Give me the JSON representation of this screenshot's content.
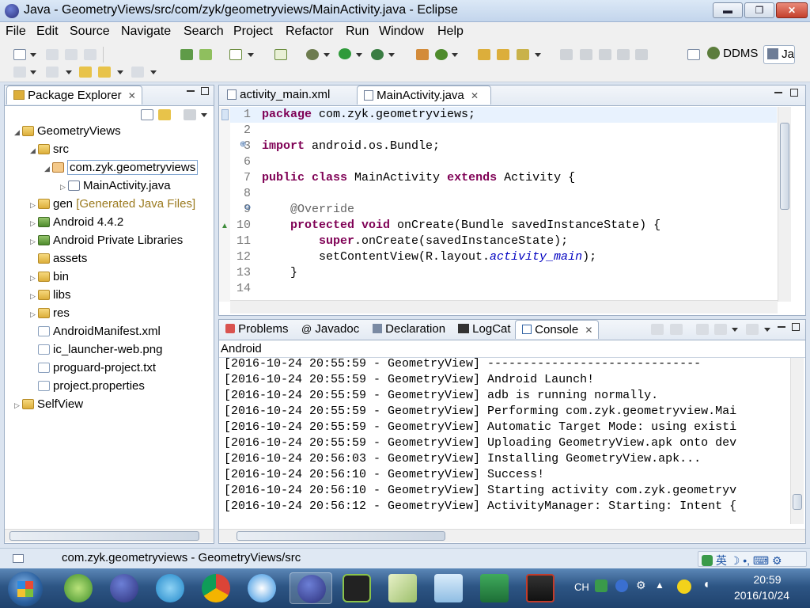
{
  "window": {
    "title": "Java - GeometryViews/src/com/zyk/geometryviews/MainActivity.java - Eclipse",
    "min_glyph": "▬",
    "max_glyph": "❐",
    "close_glyph": "✕"
  },
  "menu": [
    "File",
    "Edit",
    "Source",
    "Navigate",
    "Search",
    "Project",
    "Refactor",
    "Run",
    "Window",
    "Help"
  ],
  "perspectives": {
    "ddms": "DDMS",
    "java": "Ja"
  },
  "package_explorer": {
    "tab_label": "Package Explorer",
    "tree": [
      {
        "label": "GeometryViews",
        "arrow": "◢",
        "icon": "proj"
      },
      {
        "label": "src",
        "arrow": "◢",
        "icon": "folder"
      },
      {
        "label": "com.zyk.geometryviews",
        "arrow": "◢",
        "icon": "pkg"
      },
      {
        "label": "MainActivity.java",
        "arrow": "▷",
        "icon": "jfile"
      },
      {
        "label": "gen",
        "suffix": "[Generated Java Files]",
        "arrow": "▷",
        "icon": "folder"
      },
      {
        "label": "Android 4.4.2",
        "arrow": "▷",
        "icon": "lib"
      },
      {
        "label": "Android Private Libraries",
        "arrow": "▷",
        "icon": "lib"
      },
      {
        "label": "assets",
        "arrow": "",
        "icon": "folder"
      },
      {
        "label": "bin",
        "arrow": "▷",
        "icon": "folder"
      },
      {
        "label": "libs",
        "arrow": "▷",
        "icon": "folder"
      },
      {
        "label": "res",
        "arrow": "▷",
        "icon": "folder"
      },
      {
        "label": "AndroidManifest.xml",
        "arrow": "",
        "icon": "file"
      },
      {
        "label": "ic_launcher-web.png",
        "arrow": "",
        "icon": "file"
      },
      {
        "label": "proguard-project.txt",
        "arrow": "",
        "icon": "file"
      },
      {
        "label": "project.properties",
        "arrow": "",
        "icon": "file"
      },
      {
        "label": "SelfView",
        "arrow": "▷",
        "icon": "proj"
      }
    ]
  },
  "editor": {
    "tabs": [
      "activity_main.xml",
      "MainActivity.java"
    ],
    "lines": [
      {
        "n": "1",
        "html_parts": [
          [
            "kw",
            "package"
          ],
          [
            "",
            "com.zyk.geometryviews;"
          ]
        ]
      },
      {
        "n": "2",
        "html_parts": []
      },
      {
        "n": "3",
        "html_parts": [
          [
            "kw",
            "import"
          ],
          [
            "",
            "android.os.Bundle;"
          ]
        ]
      },
      {
        "n": "6",
        "html_parts": []
      },
      {
        "n": "7",
        "html_parts": [
          [
            "kw",
            "public"
          ],
          [
            "kw",
            "class"
          ],
          [
            "",
            "MainActivity"
          ],
          [
            "kw",
            "extends"
          ],
          [
            "",
            "Activity {"
          ]
        ]
      },
      {
        "n": "8",
        "html_parts": []
      },
      {
        "n": "9",
        "html_parts": [
          [
            "ann",
            "    @Override"
          ]
        ]
      },
      {
        "n": "10",
        "html_parts": [
          [
            "kw",
            "    protected"
          ],
          [
            "kw",
            "void"
          ],
          [
            "",
            "onCreate(Bundle savedInstanceState) {"
          ]
        ]
      },
      {
        "n": "11",
        "html_parts": [
          [
            "kw",
            "        super"
          ],
          [
            "",
            ".onCreate(savedInstanceState);"
          ]
        ]
      },
      {
        "n": "12",
        "html_parts": [
          [
            "",
            "        setContentView(R.layout."
          ],
          [
            "ital",
            "activity_main"
          ],
          [
            "",
            ");"
          ]
        ]
      },
      {
        "n": "13",
        "html_parts": [
          [
            "",
            "    }"
          ]
        ]
      },
      {
        "n": "14",
        "html_parts": []
      }
    ]
  },
  "bottom": {
    "tabs": [
      "Problems",
      "Javadoc",
      "Declaration",
      "LogCat",
      "Console"
    ],
    "console_label": "Android",
    "lines": [
      "[2016-10-24 20:55:59 - GeometryView] ------------------------------",
      "[2016-10-24 20:55:59 - GeometryView] Android Launch!",
      "[2016-10-24 20:55:59 - GeometryView] adb is running normally.",
      "[2016-10-24 20:55:59 - GeometryView] Performing com.zyk.geometryview.Mai",
      "[2016-10-24 20:55:59 - GeometryView] Automatic Target Mode: using existi",
      "[2016-10-24 20:55:59 - GeometryView] Uploading GeometryView.apk onto dev",
      "[2016-10-24 20:56:03 - GeometryView] Installing GeometryView.apk...",
      "[2016-10-24 20:56:10 - GeometryView] Success!",
      "[2016-10-24 20:56:10 - GeometryView] Starting activity com.zyk.geometryv",
      "[2016-10-24 20:56:12 - GeometryView] ActivityManager: Starting: Intent {"
    ]
  },
  "status": {
    "text": "com.zyk.geometryviews - GeometryViews/src"
  },
  "taskbar": {
    "lang": "CH",
    "ime": "英",
    "time": "20:59",
    "date": "2016/10/24"
  }
}
